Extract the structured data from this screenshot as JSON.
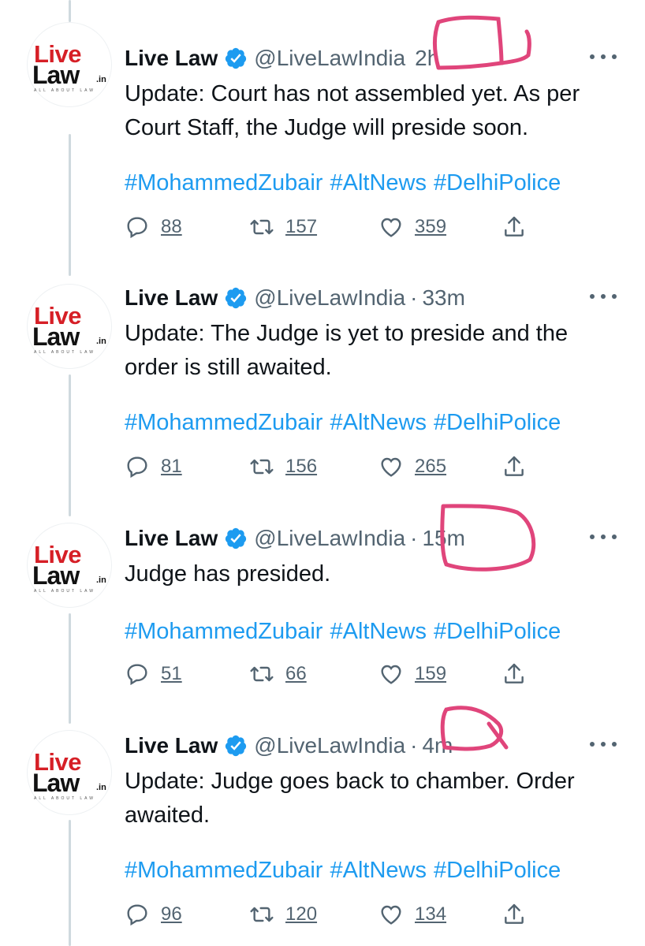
{
  "tweets": [
    {
      "name": "Live Law",
      "handle": "@LiveLawIndia",
      "separator": "",
      "time": "2h",
      "text": "Update: Court has not assembled yet. As per Court Staff, the Judge will preside soon.",
      "hashtags": "#MohammedZubair #AltNews #DelhiPolice",
      "replies": "88",
      "retweets": "157",
      "likes": "359"
    },
    {
      "name": "Live Law",
      "handle": "@LiveLawIndia",
      "separator": "·",
      "time": "33m",
      "text": "Update: The Judge is yet to preside and the order is still awaited.",
      "hashtags": "#MohammedZubair #AltNews #DelhiPolice",
      "replies": "81",
      "retweets": "156",
      "likes": "265"
    },
    {
      "name": "Live Law",
      "handle": "@LiveLawIndia",
      "separator": "·",
      "time": "15m",
      "text": "Judge has presided.",
      "hashtags": "#MohammedZubair #AltNews #DelhiPolice",
      "replies": "51",
      "retweets": "66",
      "likes": "159"
    },
    {
      "name": "Live Law",
      "handle": "@LiveLawIndia",
      "separator": "·",
      "time": "4m",
      "text": "Update: Judge goes back to chamber. Order awaited.",
      "hashtags": "#MohammedZubair #AltNews #DelhiPolice",
      "replies": "96",
      "retweets": "120",
      "likes": "134"
    }
  ],
  "logo": {
    "live": "Live",
    "law": "Law",
    "in": ".in",
    "tagline": "ALL ABOUT LAW"
  },
  "icons": {
    "verified": "verified-badge-icon",
    "more": "more-dots-icon",
    "reply": "reply-bubble-icon",
    "retweet": "retweet-icon",
    "like": "heart-icon",
    "share": "share-upload-icon"
  },
  "colors": {
    "link": "#1d9bf0",
    "muted": "#536471",
    "verified": "#1d9bf0",
    "annotation": "#e0457b",
    "logo_red": "#d61f26"
  }
}
